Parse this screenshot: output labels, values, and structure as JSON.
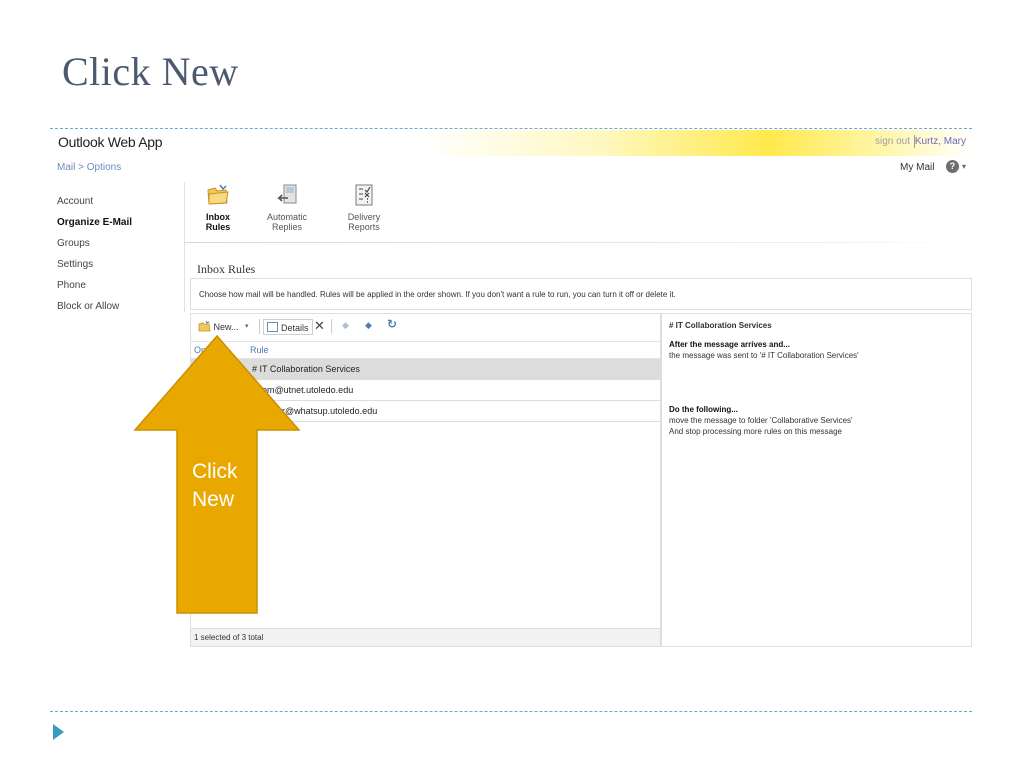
{
  "slide": {
    "title": "Click New"
  },
  "owa": {
    "app_title": "Outlook Web App",
    "sign_out": "sign out",
    "user_name": "Kurtz, Mary",
    "breadcrumb": "Mail  >  Options",
    "my_mail": "My Mail",
    "help_icon": "?",
    "help_caret": "▾"
  },
  "sidebar": {
    "items": [
      {
        "label": "Account"
      },
      {
        "label": "Organize E-Mail",
        "active": true
      },
      {
        "label": "Groups"
      },
      {
        "label": "Settings"
      },
      {
        "label": "Phone"
      },
      {
        "label": "Block or Allow"
      }
    ]
  },
  "tabs": [
    {
      "label": "Inbox Rules",
      "icon": "folder-icon",
      "active": true
    },
    {
      "label": "Automatic Replies",
      "icon": "reply-icon"
    },
    {
      "label": "Delivery Reports",
      "icon": "report-icon"
    }
  ],
  "inbox_rules": {
    "title": "Inbox Rules",
    "description": "Choose how mail will be handled. Rules will be applied in the order shown. If you don't want a rule to run, you can turn it off or delete it.",
    "toolbar": {
      "new_label": "New...",
      "new_caret": "▾",
      "details_label": "Details",
      "delete_glyph": "✕",
      "up_glyph": "◆",
      "down_glyph": "◆",
      "refresh_glyph": "↻"
    },
    "columns": {
      "on": "On",
      "rule": "Rule"
    },
    "rows": [
      {
        "text": "# IT Collaboration Services",
        "selected": true
      },
      {
        "text": "om@utnet.utoledo.edu"
      },
      {
        "text": "r@whatsup.utoledo.edu"
      }
    ],
    "status": "1 selected of 3 total"
  },
  "details": {
    "title": "# IT Collaboration Services",
    "condition_heading": "After the message arrives and...",
    "condition_text": "the message was sent to '# IT Collaboration Services'",
    "action_heading": "Do the following...",
    "action_line1": "move the message to folder 'Collaborative Services'",
    "action_line2": "And stop processing more rules on this message"
  },
  "callout": {
    "line1": "Click",
    "line2": "New",
    "color": "#e9a800",
    "border_color": "#c98f00"
  },
  "colors": {
    "link_blue": "#4d7cb8",
    "accent_teal": "#3a9bc0",
    "title_gray": "#4c5a6e"
  }
}
